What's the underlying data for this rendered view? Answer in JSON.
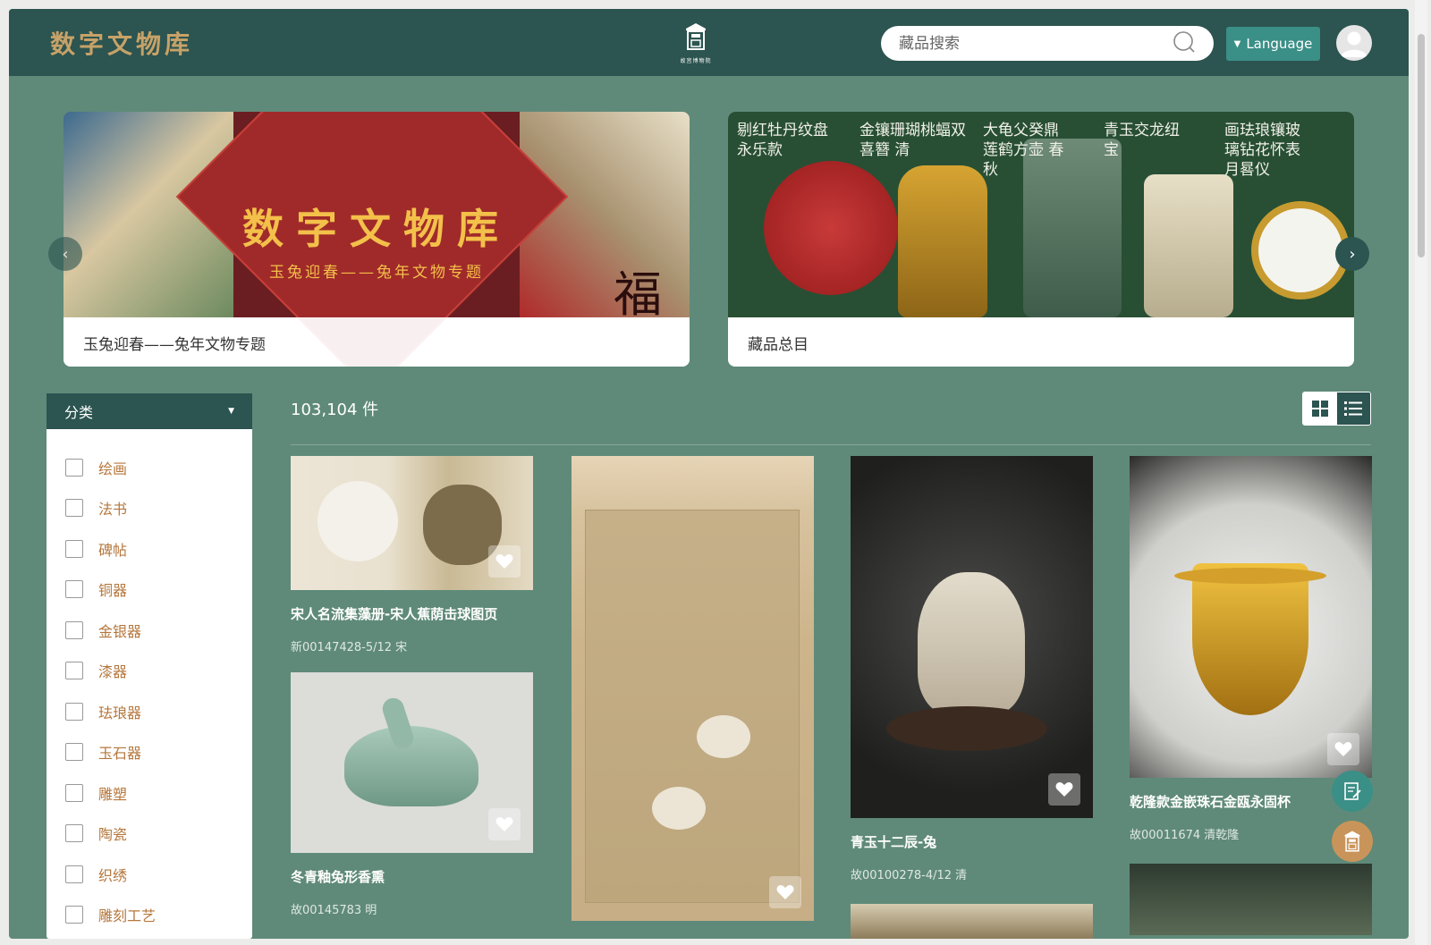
{
  "header": {
    "logo_text": "数字文物库",
    "center_logo_label": "故宫博物院",
    "search_placeholder": "藏品搜索",
    "language_label": "Language"
  },
  "banners": [
    {
      "caption": "玉兔迎春——兔年文物专题",
      "art_title": "数字文物库",
      "art_subtitle": "玉兔迎春——兔年文物专题",
      "art_seal": "福"
    },
    {
      "caption": "藏品总目",
      "art_columns": [
        "剔红牡丹纹盘 永乐款",
        "金镶珊瑚桃蝠双喜簪 清",
        "大龟父癸鼎 莲鹤方壶 春秋",
        "青玉交龙纽 宝",
        "画珐琅镶玻璃钻花怀表 月晷仪"
      ]
    }
  ],
  "sidebar": {
    "title": "分类",
    "items": [
      "绘画",
      "法书",
      "碑帖",
      "铜器",
      "金银器",
      "漆器",
      "珐琅器",
      "玉石器",
      "雕塑",
      "陶瓷",
      "织绣",
      "雕刻工艺"
    ]
  },
  "results": {
    "count_label": "103,104 件"
  },
  "cards": [
    {
      "title": "宋人名流集藻册-宋人蕉荫击球图页",
      "meta": "新00147428-5/12 宋"
    },
    {
      "title": "冬青釉兔形香熏",
      "meta": "故00145783 明"
    },
    {
      "title": "",
      "meta": ""
    },
    {
      "title": "青玉十二辰-兔",
      "meta": "故00100278-4/12 清"
    },
    {
      "title": "乾隆款金嵌珠石金瓯永固杯",
      "meta": "故00011674 清乾隆"
    }
  ],
  "colors": {
    "page_bg": "#5f8a79",
    "header_bg": "#2c5450",
    "accent": "#3a8f86",
    "sidebar_label": "#b5773c",
    "logo_gold": "#c7a268"
  }
}
